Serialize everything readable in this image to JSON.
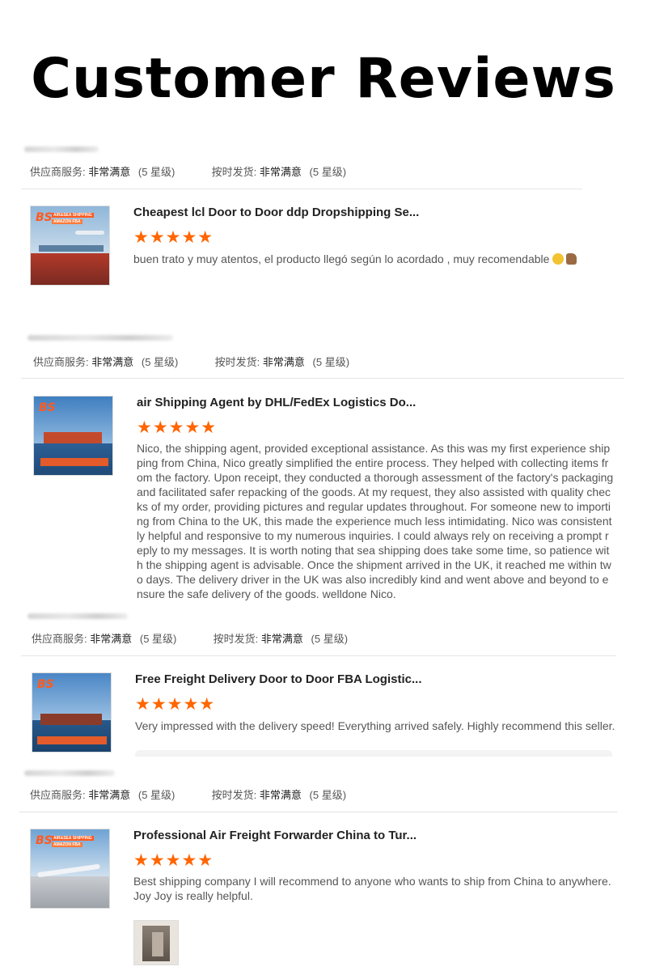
{
  "page": {
    "title": "Customer Reviews"
  },
  "labels": {
    "service": "供应商服务:",
    "delivery": "按时发货:",
    "value": "非常满意",
    "grade": "(5 星级)"
  },
  "reviews": [
    {
      "product_title": "Cheapest lcl Door to Door ddp Dropshipping Se...",
      "stars": "★★★★★",
      "comment": "buen  trato y muy atentos, el producto llegó según lo acordado , muy recomendable",
      "emoji": [
        "smiling-face-icon",
        "thumbs-up-icon"
      ]
    },
    {
      "product_title": "air Shipping Agent by DHL/FedEx Logistics Do...",
      "stars": "★★★★★",
      "comment": "Nico, the shipping agent, provided exceptional assistance. As this was my first experience shipping from China, Nico greatly simplified the entire process. They helped with collecting items from the factory. Upon receipt, they conducted a thorough assessment of the factory's packaging and facilitated safer repacking of the goods. At my request, they also assisted with quality checks of my order, providing pictures and regular updates throughout. For someone new to importing from China to the UK, this made the experience much less intimidating. Nico was consistently helpful and responsive to my numerous inquiries. I could always rely on receiving a prompt reply to my messages. It is worth noting that sea shipping does take some time, so patience with the shipping agent is advisable. Once the shipment arrived in the UK, it reached me within two days. The delivery driver in the UK was also incredibly kind and went above and beyond to ensure the safe delivery of the goods. welldone Nico."
    },
    {
      "product_title": "Free Freight Delivery Door to Door FBA Logistic...",
      "stars": "★★★★★",
      "comment": "Very impressed with the delivery speed! Everything arrived safely. Highly recommend this seller."
    },
    {
      "product_title": "Professional Air Freight Forwarder China to Tur...",
      "stars": "★★★★★",
      "comment": "Best shipping company I will recommend to anyone who wants to ship from China to anywhere. Joy Joy is really helpful."
    }
  ],
  "thumb": {
    "logo": "BS",
    "tag1": "AIR&SEA SHIPPING",
    "tag2": "AMAZON FBA"
  },
  "colors": {
    "accent": "#ff6600",
    "text": "#555555",
    "title": "#000000"
  }
}
